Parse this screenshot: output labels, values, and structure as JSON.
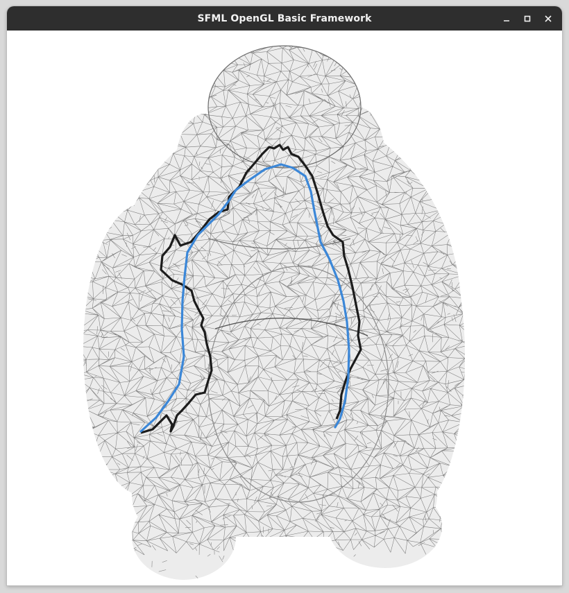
{
  "window": {
    "title": "SFML OpenGL Basic Framework"
  },
  "controls": {
    "minimize_icon": "minimize-icon",
    "maximize_icon": "maximize-icon",
    "close_icon": "close-icon"
  },
  "viewport": {
    "subject": "buddha-mesh",
    "mesh_fill": "#ececec",
    "wire_color": "#7a7a7a",
    "boundary_path_color": "#1c1c1c",
    "geodesic_path_color": "#3b87d8"
  }
}
